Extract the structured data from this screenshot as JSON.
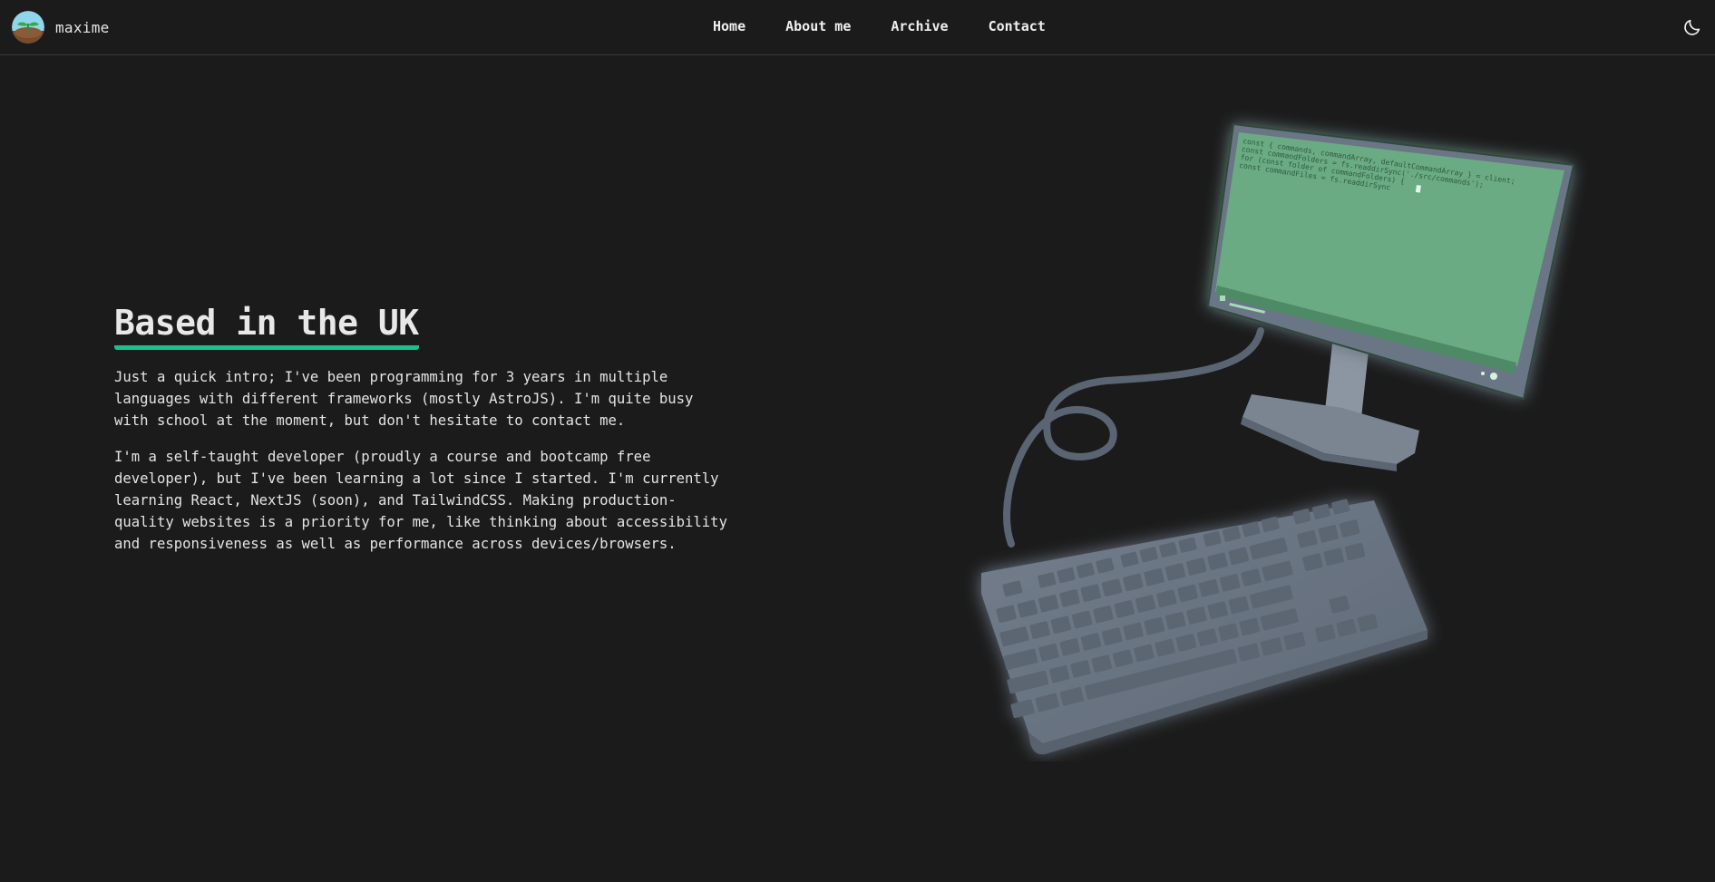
{
  "header": {
    "brand_name": "maxime",
    "nav": [
      "Home",
      "About me",
      "Archive",
      "Contact"
    ],
    "theme_icon": "moon-icon"
  },
  "intro": {
    "heading": "Based in the UK",
    "paragraphs": [
      "Just a quick intro; I've been programming for 3 years in multiple languages with different frameworks (mostly AstroJS). I'm quite busy with school at the moment, but don't hesitate to contact me.",
      "I'm a self-taught developer (proudly a course and bootcamp free developer), but I've been learning a lot since I started. I'm currently learning React, NextJS (soon), and TailwindCSS. Making production-quality websites is a priority for me, like thinking about accessibility and responsiveness as well as performance across devices/browsers."
    ]
  },
  "illustration": {
    "code_lines": [
      "const { commands, commandArray, defaultCommandArray } = client;",
      "const commandFolders = fs.readdirSync('./src/commands');",
      "for (const folder of commandFolders) {",
      "  const commandFiles = fs.readdirSync"
    ]
  },
  "colors": {
    "background": "#1b1b1b",
    "accent": "#19c08f",
    "screen": "#6aab84",
    "device": "#6b7685"
  }
}
